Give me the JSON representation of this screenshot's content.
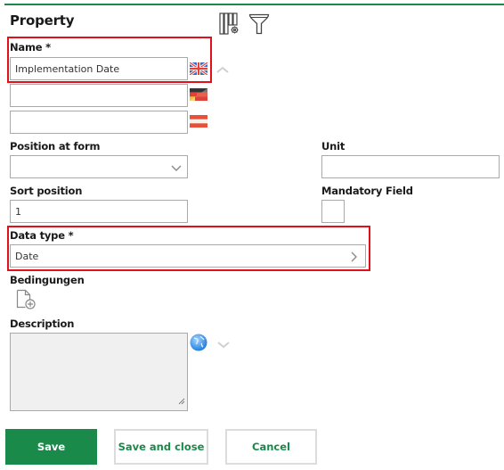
{
  "header": {
    "title": "Property",
    "icons": [
      "column-settings-icon",
      "filter-icon"
    ]
  },
  "name_field": {
    "label": "Name *",
    "values": [
      {
        "lang": "en",
        "flag": "uk-flag-icon",
        "value": "Implementation Date"
      },
      {
        "lang": "de",
        "flag": "germany-flag-icon",
        "value": ""
      },
      {
        "lang": "at",
        "flag": "austria-flag-icon",
        "value": ""
      }
    ],
    "collapse_icon": "chevron-up-icon"
  },
  "position_at_form": {
    "label": "Position at form",
    "value": ""
  },
  "unit": {
    "label": "Unit",
    "value": ""
  },
  "sort_position": {
    "label": "Sort position",
    "value": "1"
  },
  "mandatory_field": {
    "label": "Mandatory Field",
    "checked": false
  },
  "data_type": {
    "label": "Data type *",
    "value": "Date"
  },
  "conditions": {
    "label": "Bedingungen",
    "icon": "add-document-icon"
  },
  "description": {
    "label": "Description",
    "value": "",
    "language_icon": "globe-icon",
    "expand_icon": "chevron-down-icon"
  },
  "buttons": {
    "save": "Save",
    "save_and_close": "Save and close",
    "cancel": "Cancel"
  },
  "colors": {
    "accent": "#1a8a4a",
    "highlight": "#e0111b"
  }
}
